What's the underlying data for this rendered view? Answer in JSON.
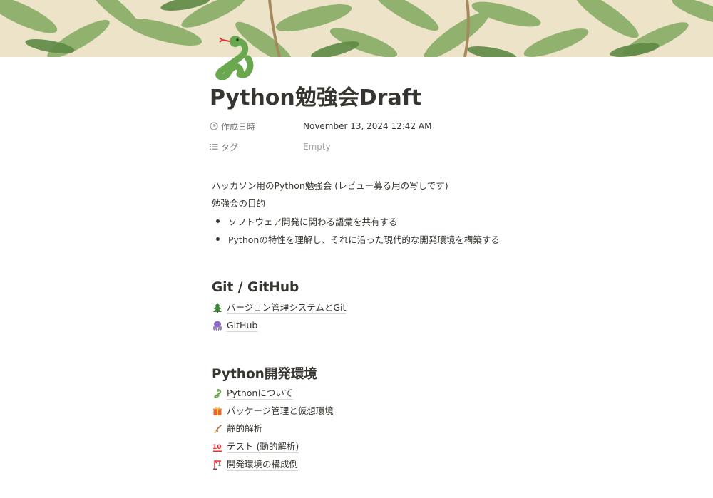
{
  "cover": {
    "icon": "leaf-pattern-cover"
  },
  "page_icon": "python-snake-icon",
  "title": "Python勉強会Draft",
  "properties": [
    {
      "icon": "clock-icon",
      "name": "作成日時",
      "value": "November 13, 2024 12:42 AM"
    },
    {
      "icon": "list-icon",
      "name": "タグ",
      "value": "Empty"
    }
  ],
  "intro": {
    "line1": "ハッカソン用のPython勉強会 (レビュー募る用の写しです)",
    "line2": "勉強会の目的",
    "bullets": [
      "ソフトウェア開発に関わる語彙を共有する",
      "Pythonの特性を理解し、それに沿った現代的な開発環境を構築する"
    ]
  },
  "sections": [
    {
      "heading": "Git / GitHub",
      "links": [
        {
          "icon": "tree-icon",
          "label": "バージョン管理システムとGit"
        },
        {
          "icon": "octopus-icon",
          "label": "GitHub"
        }
      ]
    },
    {
      "heading": "Python開発環境",
      "links": [
        {
          "icon": "snake-icon",
          "label": "Pythonについて"
        },
        {
          "icon": "gift-icon",
          "label": "パッケージ管理と仮想環境"
        },
        {
          "icon": "broom-icon",
          "label": "静的解析"
        },
        {
          "icon": "hundred-points-icon",
          "label": "テスト (動的解析)"
        },
        {
          "icon": "construction-crane-icon",
          "label": "開発環境の構成例"
        }
      ]
    }
  ],
  "colors": {
    "text": "#37352f",
    "muted": "#787774",
    "placeholder": "#a3a29e",
    "cover_bg": "#ede3c9",
    "leaf": "#7fa45f"
  }
}
